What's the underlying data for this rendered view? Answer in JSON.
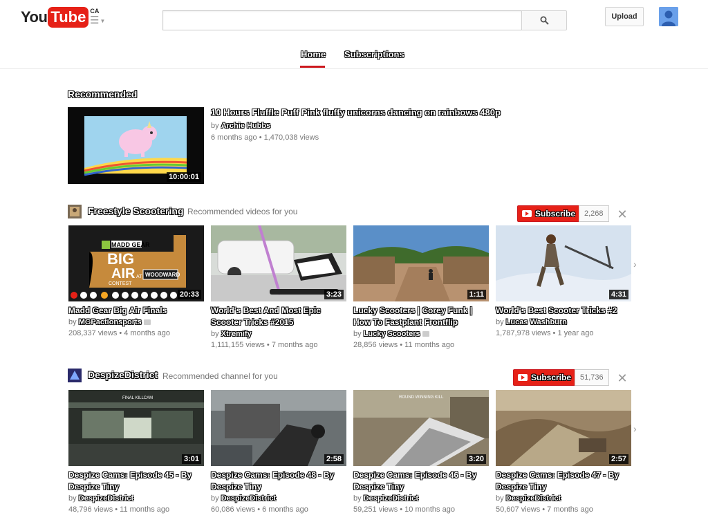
{
  "header": {
    "logo_you": "You",
    "logo_tube": "Tube",
    "logo_region": "CA",
    "search_placeholder": "",
    "upload_label": "Upload"
  },
  "tabs": [
    {
      "label": "Home",
      "active": true
    },
    {
      "label": "Subscriptions",
      "active": false
    }
  ],
  "recommended": {
    "heading": "Recommended",
    "video": {
      "title": "10 Hours Fluffle Puff Pink fluffy unicorns dancing on rainbows 480p",
      "by_prefix": "by",
      "channel": "Archie Hubbs",
      "meta": "6 months ago  •  1,470,038 views",
      "duration": "10:00:01"
    }
  },
  "shelves": [
    {
      "name": "Freestyle Scootering",
      "subtitle": "Recommended videos for you",
      "subscribe_label": "Subscribe",
      "subscriber_count": "2,268",
      "videos": [
        {
          "title": "Madd Gear Big Air Finals",
          "channel": "MGPactionsports",
          "verified": true,
          "meta": "208,337 views  •  4 months ago",
          "duration": "20:33"
        },
        {
          "title": "World's Best And Most Epic Scooter Tricks #2015",
          "channel": "Xtremify",
          "verified": false,
          "meta": "1,111,155 views  •  7 months ago",
          "duration": "3:23"
        },
        {
          "title": "Lucky Scooters | Corey Funk | How To Fastplant Frontflip",
          "channel": "Lucky Scooters",
          "verified": true,
          "meta": "28,856 views  •  11 months ago",
          "duration": "1:11"
        },
        {
          "title": "World's Best Scooter Tricks #2",
          "channel": "Lucas Washburn",
          "verified": false,
          "meta": "1,787,978 views  •  1 year ago",
          "duration": "4:31"
        }
      ]
    },
    {
      "name": "DespizeDistrict",
      "subtitle": "Recommended channel for you",
      "subscribe_label": "Subscribe",
      "subscriber_count": "51,736",
      "videos": [
        {
          "title": "Despize Cams: Episode 45 - By Despize Tiny",
          "channel": "DespizeDistrict",
          "verified": false,
          "meta": "48,796 views  •  11 months ago",
          "duration": "3:01"
        },
        {
          "title": "Despize Cams: Episode 48 - By Despize Tiny",
          "channel": "DespizeDistrict",
          "verified": false,
          "meta": "60,086 views  •  6 months ago",
          "duration": "2:58"
        },
        {
          "title": "Despize Cams: Episode 46 - By Despize Tiny",
          "channel": "DespizeDistrict",
          "verified": false,
          "meta": "59,251 views  •  10 months ago",
          "duration": "3:20"
        },
        {
          "title": "Despize Cams: Episode 47 - By Despize Tiny",
          "channel": "DespizeDistrict",
          "verified": false,
          "meta": "50,607 views  •  7 months ago",
          "duration": "2:57"
        }
      ]
    }
  ],
  "by_prefix": "by",
  "thumb_text": {
    "madd_gear": "MADD GEAR",
    "big": "BIG",
    "air": "AIR",
    "contest": "CONTEST",
    "at": "AT",
    "woodward": "WOODWARD",
    "final_killcam": "FINAL KILLCAM",
    "round_winning_kill": "ROUND WINNING KILL"
  },
  "colors": {
    "brand_red": "#e62117",
    "tab_underline": "#cc181e"
  }
}
